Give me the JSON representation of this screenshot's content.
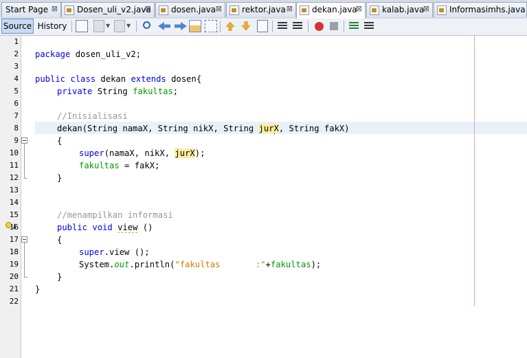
{
  "tabs": [
    {
      "label": "Start Page",
      "close": "⊠",
      "active": false
    },
    {
      "label": "Dosen_uli_v2.java",
      "close": "⊠",
      "active": false
    },
    {
      "label": "dosen.java",
      "close": "⊠",
      "active": false
    },
    {
      "label": "rektor.java",
      "close": "⊠",
      "active": false
    },
    {
      "label": "dekan.java",
      "close": "⊠",
      "active": true
    },
    {
      "label": "kalab.java",
      "close": "⊠",
      "active": false
    },
    {
      "label": "Informasimhs.java",
      "close": "",
      "active": false
    }
  ],
  "toolbar": {
    "source_label": "Source",
    "history_label": "History"
  },
  "line_numbers": [
    "1",
    "2",
    "3",
    "4",
    "5",
    "6",
    "7",
    "8",
    "9",
    "10",
    "11",
    "12",
    "13",
    "14",
    "15",
    "16",
    "17",
    "18",
    "19",
    "20",
    "21",
    "22"
  ],
  "code": {
    "l2_kw": "package",
    "l2_rest": " dosen_uli_v2;",
    "l4_kw1": "public",
    "l4_sp1": " ",
    "l4_kw2": "class",
    "l4_name": " dekan ",
    "l4_kw3": "extends",
    "l4_rest": " dosen{",
    "l5_kw": "private",
    "l5_type": " String ",
    "l5_field": "fakultas",
    "l5_end": ";",
    "l7_comment": "//Inisialisasi",
    "l8_a": "dekan(String namaX, String nikX, String ",
    "l8_jur_a": "jur",
    "l8_jur_b": "X",
    "l8_b": ", String fakX)",
    "l9": "{",
    "l10_kw": "super",
    "l10_a": "(namaX, nikX, ",
    "l10_jur": "jurX",
    "l10_b": ");",
    "l11_field": "fakultas",
    "l11_rest": " = fakX;",
    "l12": "}",
    "l15_comment": "//menampilkan informasi",
    "l16_kw1": "public",
    "l16_kw2": "void",
    "l16_name": "view",
    "l16_rest": " ()",
    "l17": "{",
    "l18_kw": "super",
    "l18_rest": ".view ();",
    "l19_a": "System.",
    "l19_out": "out",
    "l19_b": ".println(",
    "l19_str": "\"fakultas       :\"",
    "l19_c": "+",
    "l19_field": "fakultas",
    "l19_d": ");",
    "l20": "}",
    "l21": "}"
  },
  "colors": {
    "keyword": "#0000e6",
    "comment": "#969696",
    "field": "#009900",
    "string": "#ce7b00",
    "current_line": "#e8f0fb",
    "mark_occurrence": "#ffee9e"
  }
}
